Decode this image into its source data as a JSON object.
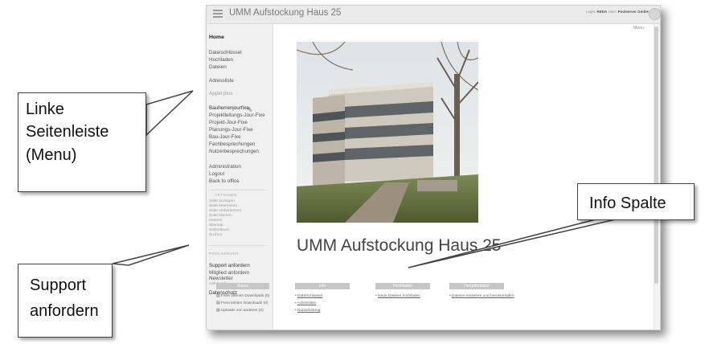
{
  "app": {
    "title": "UMM Aufstockung Haus 25",
    "login_label": "Login:",
    "login_user": "REDA",
    "user_label": "User:",
    "user_org": "Poolserver GmbH"
  },
  "sidebar": {
    "home": "Home",
    "group1": [
      "Dateischlüssel",
      "Hochladen",
      "Dateien"
    ],
    "adressliste": "Adressliste",
    "appel_plus": "Appel plus",
    "meetings": [
      "Bauherrenjourfixe",
      "Projektleitungs-Jour-Fixe",
      "Projekt-Jour-Fixe",
      "Planungs-Jour-Fixe",
      "Bau-Jour-Fixe",
      "Fachbesprechungen",
      "Nutzerbesprechungen"
    ],
    "admin": [
      "Administration",
      "Logout",
      "Back to office"
    ],
    "aktionen_head": "AKTIONEN",
    "aktionen": [
      "Seite anzeigen",
      "Seite bearbeiten",
      "Seite umbenennen",
      "Seite löschen",
      "Historie",
      "Sitemap",
      "Seitenbaum",
      "Suchen"
    ],
    "poolserver_head": "POOLSERVER",
    "poolserver": [
      "Support anfordern",
      "Mitglied anfordern",
      "Newsletter"
    ],
    "admin_info": "Admin info",
    "datenschutz": "Datenschutz"
  },
  "main": {
    "menu_link": "Menu",
    "heading": "UMM Aufstockung Haus 25",
    "photo_alt": "building-photo",
    "columns": [
      {
        "header": "Status",
        "items": [
          "Freie offenen Downloads (0)",
          "Freie letzten Downloads (0)",
          "Uploads von anderen (0)"
        ]
      },
      {
        "header": "Info",
        "items": [
          "Dateischlüssel",
          "Adressliste",
          "Nutzerleitung"
        ]
      },
      {
        "header": "Hochladen",
        "items": [
          "Neue Dateien hochladen"
        ]
      },
      {
        "header": "Herunterladen",
        "items": [
          "Dateien einsehen und herunterladen"
        ]
      }
    ]
  },
  "callouts": {
    "sidebar_note": [
      "Linke",
      "Seitenleiste",
      "(Menu)"
    ],
    "info_note": "Info Spalte",
    "support_note": [
      "Support",
      "anfordern"
    ]
  }
}
